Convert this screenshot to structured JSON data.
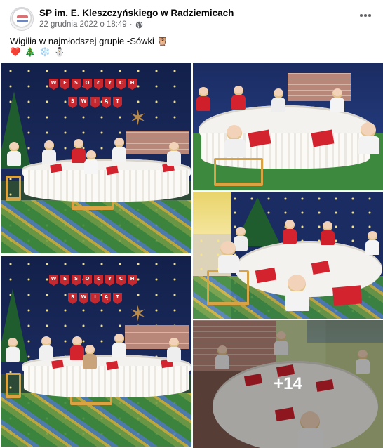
{
  "post": {
    "author": "SP im. E. Kleszczyńskiego w Radziemicach",
    "date": "22 grudnia 2022 o 18:49",
    "audience_icon": "globe-icon",
    "menu_icon": "more-options-icon",
    "text": "Wigilia w najmłodszej grupie -Sówki",
    "text_emoji": "🦉",
    "emojis": [
      "❤️",
      "🎄",
      "❄️",
      "⛄"
    ]
  },
  "gallery": {
    "photos": [
      {
        "label": "photo-1",
        "banner_lines": [
          "WESOŁYCH",
          "ŚWIĄT"
        ]
      },
      {
        "label": "photo-2"
      },
      {
        "label": "photo-3",
        "banner_lines": [
          "WESOŁYCH",
          "ŚWIĄT"
        ]
      },
      {
        "label": "photo-4"
      },
      {
        "label": "photo-5"
      }
    ],
    "more_count": "+14"
  },
  "colors": {
    "text_primary": "#050505",
    "text_secondary": "#65676b",
    "backdrop_navy": "#1b2b5e",
    "banner_red": "#c5282f",
    "napkin_red": "#d2232f"
  }
}
